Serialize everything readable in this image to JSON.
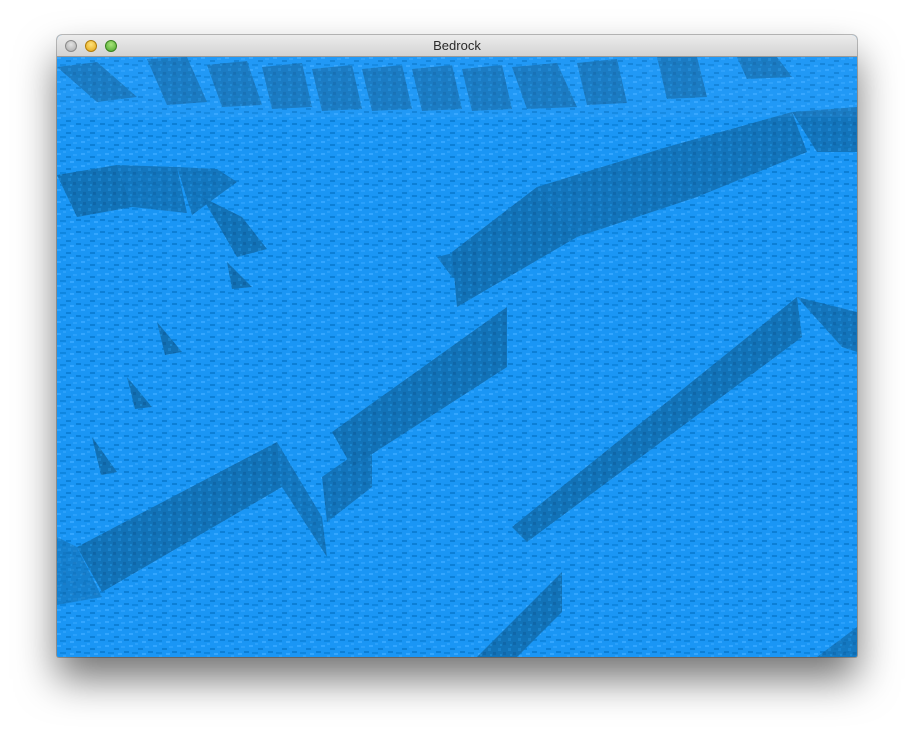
{
  "window": {
    "title": "Bedrock"
  },
  "scene": {
    "description_icon": "voxel-terrain-view",
    "colors": {
      "top_surface": "#1a96f5",
      "side_face": "#1270b4",
      "side_face_dark": "#0f5f9c",
      "texture_light": "#33a6ff",
      "texture_dark": "#0c7fd6"
    }
  }
}
